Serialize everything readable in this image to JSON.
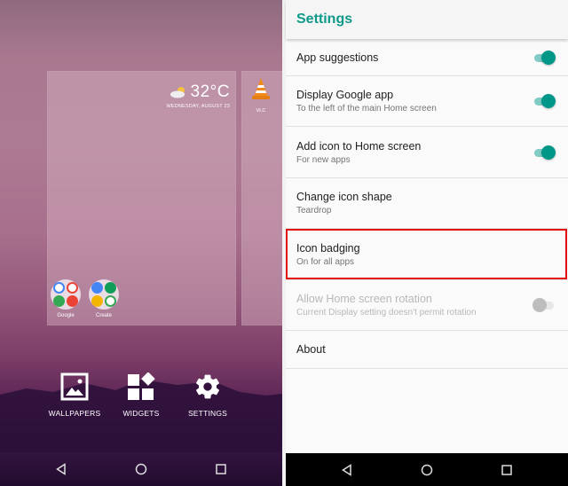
{
  "home_screen": {
    "weather": {
      "temperature": "32°C",
      "date": "WEDNESDAY, AUGUST 23",
      "icon": "partly-cloudy-icon"
    },
    "apps": [
      {
        "label": "VLC",
        "icon": "vlc-cone-icon"
      }
    ],
    "folders": [
      {
        "label": "Google",
        "icon": "google-apps-folder-icon"
      },
      {
        "label": "Create",
        "icon": "create-apps-folder-icon"
      }
    ],
    "actions": [
      {
        "label": "WALLPAPERS",
        "icon": "wallpaper-icon"
      },
      {
        "label": "WIDGETS",
        "icon": "widgets-icon"
      },
      {
        "label": "SETTINGS",
        "icon": "gear-icon"
      }
    ]
  },
  "settings": {
    "title": "Settings",
    "accent_color": "#009688",
    "highlight_color": "#e01010",
    "items": [
      {
        "title": "App suggestions",
        "subtitle": "",
        "toggle": "on",
        "enabled": true
      },
      {
        "title": "Display Google app",
        "subtitle": "To the left of the main Home screen",
        "toggle": "on",
        "enabled": true
      },
      {
        "title": "Add icon to Home screen",
        "subtitle": "For new apps",
        "toggle": "on",
        "enabled": true
      },
      {
        "title": "Change icon shape",
        "subtitle": "Teardrop",
        "toggle": null,
        "enabled": true
      },
      {
        "title": "Icon badging",
        "subtitle": "On for all apps",
        "toggle": null,
        "enabled": true,
        "highlighted": true
      },
      {
        "title": "Allow Home screen rotation",
        "subtitle": "Current Display setting doesn't permit rotation",
        "toggle": "off",
        "enabled": false
      },
      {
        "title": "About",
        "subtitle": "",
        "toggle": null,
        "enabled": true
      }
    ]
  },
  "navigation": {
    "buttons": [
      "back",
      "home",
      "recents"
    ]
  }
}
